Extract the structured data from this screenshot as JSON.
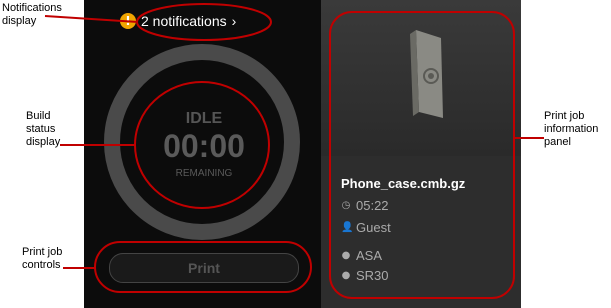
{
  "callouts": {
    "notifications": "Notifications\ndisplay",
    "build_status": "Build\nstatus\ndisplay",
    "print_controls": "Print job\ncontrols",
    "job_info": "Print job\ninformation\npanel"
  },
  "notifications": {
    "text": "2 notifications",
    "chevron": "›",
    "icon": "warning-icon"
  },
  "build": {
    "status": "IDLE",
    "time": "00:00",
    "remaining_label": "REMAINING"
  },
  "controls": {
    "print_label": "Print"
  },
  "job": {
    "name": "Phone_case.cmb.gz",
    "duration": "05:22",
    "user": "Guest",
    "materials": [
      "ASA",
      "SR30"
    ]
  },
  "colors": {
    "accent_warning": "#f0a500",
    "callout": "#c00000"
  }
}
